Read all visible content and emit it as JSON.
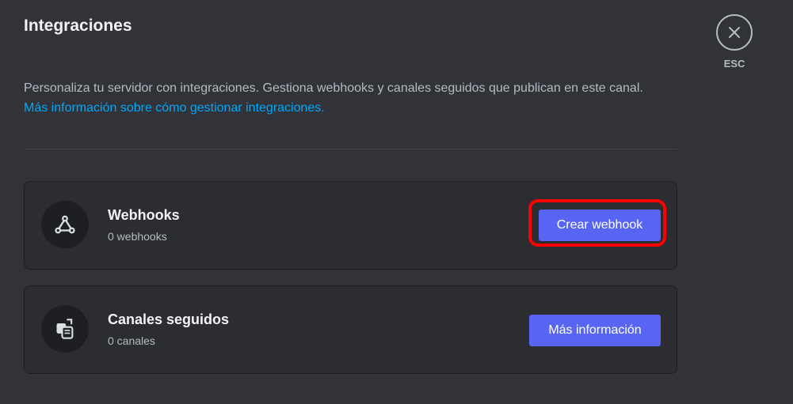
{
  "page": {
    "title": "Integraciones",
    "description": "Personaliza tu servidor con integraciones. Gestiona webhooks y canales seguidos que publican en este canal.",
    "help_link": "Más información sobre cómo gestionar integraciones."
  },
  "close": {
    "label": "ESC",
    "icon": "close-icon"
  },
  "sections": {
    "webhooks": {
      "title": "Webhooks",
      "subtitle": "0 webhooks",
      "button": "Crear webhook",
      "icon": "webhook-icon"
    },
    "followed_channels": {
      "title": "Canales seguidos",
      "subtitle": "0 canales",
      "button": "Más información",
      "icon": "followed-channel-icon"
    }
  },
  "colors": {
    "background": "#313338",
    "card": "#2b2d31",
    "accent": "#5865f2",
    "link": "#00a8fc",
    "highlight": "#ff0000"
  }
}
